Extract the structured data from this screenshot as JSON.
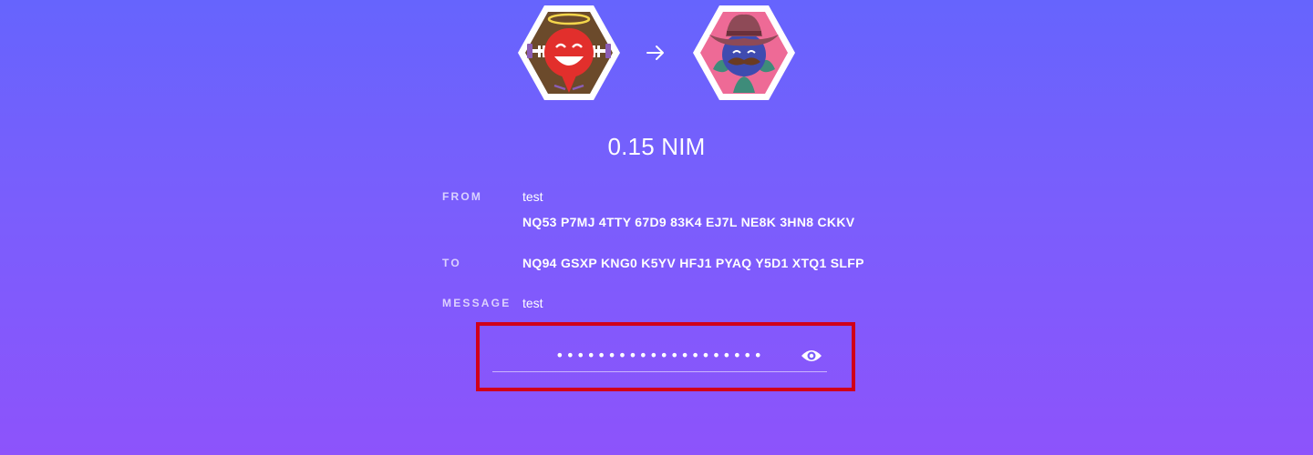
{
  "transaction": {
    "amount": "0.15 NIM",
    "from": {
      "label": "FROM",
      "name": "test",
      "address": "NQ53 P7MJ 4TTY 67D9 83K4 EJ7L NE8K 3HN8 CKKV"
    },
    "to": {
      "label": "TO",
      "address": "NQ94 GSXP KNG0 K5YV HFJ1 PYAQ Y5D1 XTQ1 SLFP"
    },
    "message": {
      "label": "MESSAGE",
      "text": "test"
    }
  },
  "password": {
    "value": "••••••••••••••••••••",
    "visibility_icon": "eye-icon"
  },
  "icons": {
    "from_identicon": "sender-identicon",
    "arrow": "arrow-right-icon",
    "to_identicon": "recipient-identicon"
  },
  "colors": {
    "gradient_top": "#6664fd",
    "gradient_bottom": "#8d53fb",
    "highlight_border": "#d10019",
    "from_identicon_bg": "#6b4a2b",
    "to_identicon_bg": "#ee6a96"
  }
}
